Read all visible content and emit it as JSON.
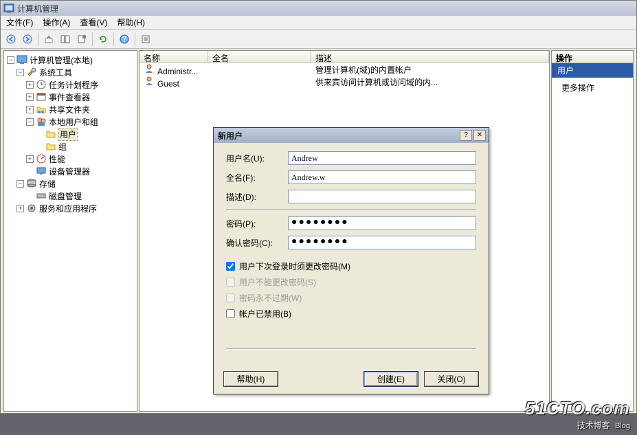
{
  "title": "计算机管理",
  "menu": {
    "file": "文件(F)",
    "action": "操作(A)",
    "view": "查看(V)",
    "help": "帮助(H)"
  },
  "tree": {
    "root": "计算机管理(本地)",
    "system_tools": "系统工具",
    "task_scheduler": "任务计划程序",
    "event_viewer": "事件查看器",
    "shared_folders": "共享文件夹",
    "local_users_groups": "本地用户和组",
    "users": "用户",
    "groups": "组",
    "performance": "性能",
    "device_manager": "设备管理器",
    "storage": "存储",
    "disk_management": "磁盘管理",
    "services_apps": "服务和应用程序"
  },
  "columns": {
    "name": "名称",
    "fullname": "全名",
    "description": "描述"
  },
  "list": [
    {
      "name": "Administr...",
      "fullname": "",
      "description": "管理计算机(域)的内置帐户"
    },
    {
      "name": "Guest",
      "fullname": "",
      "description": "供来宾访问计算机或访问域的内..."
    }
  ],
  "actions_pane": {
    "header": "操作",
    "selected": "用户",
    "more": "更多操作"
  },
  "dialog": {
    "title": "新用户",
    "username_label": "用户名(U):",
    "fullname_label": "全名(F):",
    "description_label": "描述(D):",
    "password_label": "密码(P):",
    "confirm_label": "确认密码(C):",
    "username_value": "Andrew",
    "fullname_value": "Andrew.w",
    "description_value": "",
    "password_value": "●●●●●●●●",
    "confirm_value": "●●●●●●●●",
    "cb_must_change": "用户下次登录时须更改密码(M)",
    "cb_cannot_change": "用户不能更改密码(S)",
    "cb_never_expire": "密码永不过期(W)",
    "cb_disabled": "帐户已禁用(B)",
    "btn_help": "帮助(H)",
    "btn_create": "创建(E)",
    "btn_close": "关闭(O)"
  },
  "watermark": {
    "main": "51CTO.com",
    "sub": "技术博客",
    "tag": "Blog"
  }
}
